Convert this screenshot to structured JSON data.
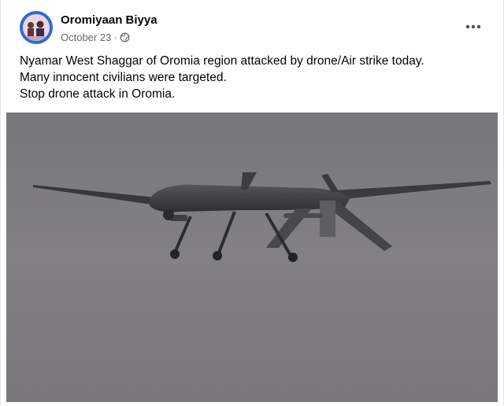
{
  "post": {
    "author": "Oromiyaan Biyya",
    "date": "October 23",
    "separator": "·",
    "privacy_icon": "globe-icon",
    "more_icon": "more-options-icon",
    "text_lines": [
      "Nyamar West Shaggar of Oromia region attacked by drone/Air strike today.",
      "Many innocent civilians were targeted.",
      "Stop drone attack in Oromia."
    ],
    "image_icon": "drone-photo"
  },
  "colors": {
    "author_text": "#050505",
    "meta_text": "#65676b",
    "avatar_ring": "#2f6bd6",
    "sky": "#7c7b7f",
    "drone": "#3a3b3f"
  }
}
